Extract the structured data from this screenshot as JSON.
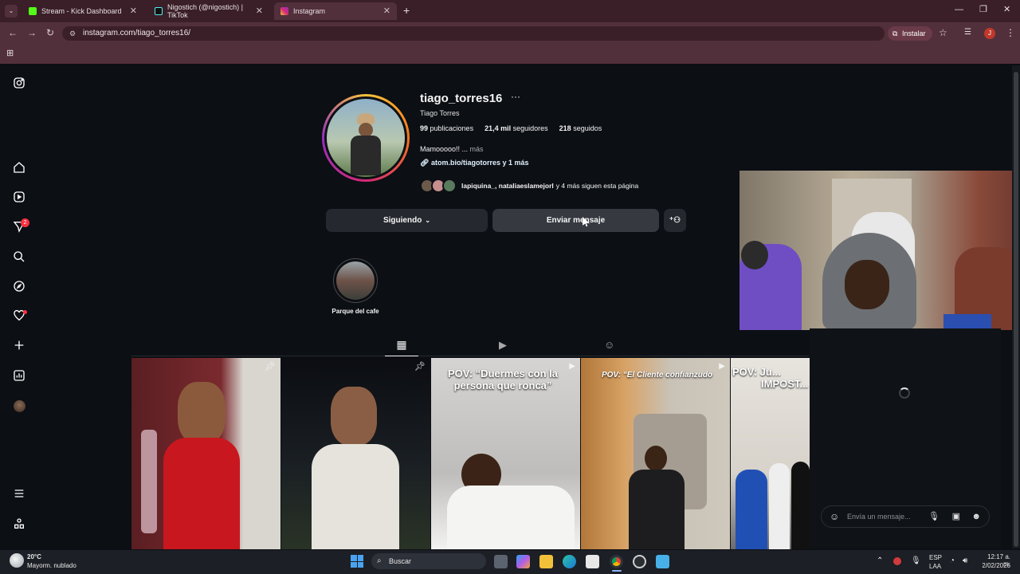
{
  "browser": {
    "tabs": [
      {
        "title": "Stream - Kick Dashboard",
        "icon": "kick-icon",
        "color": "#53fc18"
      },
      {
        "title": "Nigostich (@nigostich) | TikTok",
        "icon": "tiktok-icon",
        "color": "#ffffff"
      },
      {
        "title": "Instagram",
        "icon": "instagram-icon",
        "color": "#e1306c"
      }
    ],
    "url": "instagram.com/tiago_torres16/",
    "install_label": "Instalar",
    "profile_initial": "J"
  },
  "sidebar": {
    "notifications_badge": "2"
  },
  "profile": {
    "username": "tiago_torres16",
    "full_name": "Tiago Torres",
    "posts_count": "99",
    "posts_label": "publicaciones",
    "followers_count": "21,4 mil",
    "followers_label": "seguidores",
    "following_count": "218",
    "following_label": "seguidos",
    "bio": "Mamooooo!! ...",
    "bio_more": "más",
    "link": "atom.bio/tiagotorres y 1 más",
    "followed_by_names": "lapiquina_, nataliaeslamejorl",
    "followed_by_rest": "y 4 más siguen esta página",
    "following_button": "Siguiendo",
    "message_button": "Enviar mensaje",
    "highlight_label": "Parque del cafe"
  },
  "posts": [
    {
      "caption": "",
      "pinned": true,
      "reel": false
    },
    {
      "caption": "",
      "pinned": true,
      "reel": false
    },
    {
      "caption": "POV: “Duermes con la persona que ronca”",
      "pinned": false,
      "reel": true
    },
    {
      "caption": "POV: “El Cliente confianzudo",
      "pinned": false,
      "reel": true
    },
    {
      "caption": "POV: Ju... IMPOST...",
      "pinned": false,
      "reel": false
    }
  ],
  "chat": {
    "placeholder": "Envía un mensaje..."
  },
  "taskbar": {
    "weather_temp": "20°C",
    "weather_desc": "Mayorm. nublado",
    "search_label": "Buscar",
    "lang": "ESP",
    "lang_sub": "LAA",
    "time": "12:17 a. m.",
    "date": "2/02/2026"
  },
  "colors": {
    "tabbar": "#3a1f28",
    "toolbar": "#52303b",
    "background": "#0c0f14",
    "button": "#25292f"
  }
}
